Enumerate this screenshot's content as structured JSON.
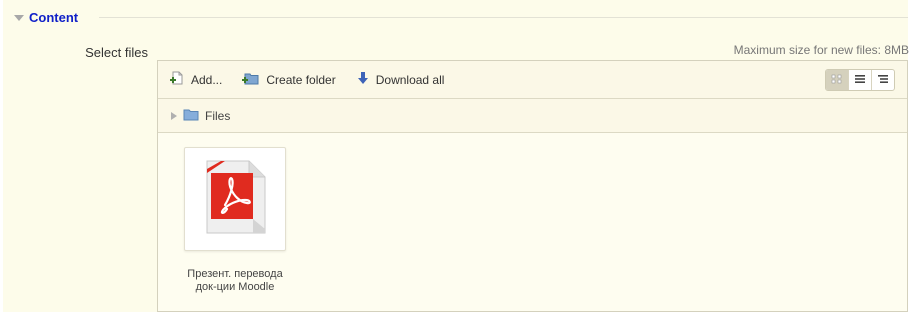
{
  "section": {
    "title": "Content"
  },
  "field": {
    "label": "Select files",
    "max_size": "Maximum size for new files: 8MB"
  },
  "toolbar": {
    "add_label": "Add...",
    "create_folder_label": "Create folder",
    "download_all_label": "Download all"
  },
  "path": {
    "label": "Files"
  },
  "files": [
    {
      "name_line1": "Презент. перевода",
      "name_line2": "док-ции Moodle",
      "type_icon": "pdf-icon"
    }
  ],
  "colors": {
    "accent": "#1020c8",
    "background": "#fdfcea",
    "pdf_red": "#e02b1f"
  }
}
